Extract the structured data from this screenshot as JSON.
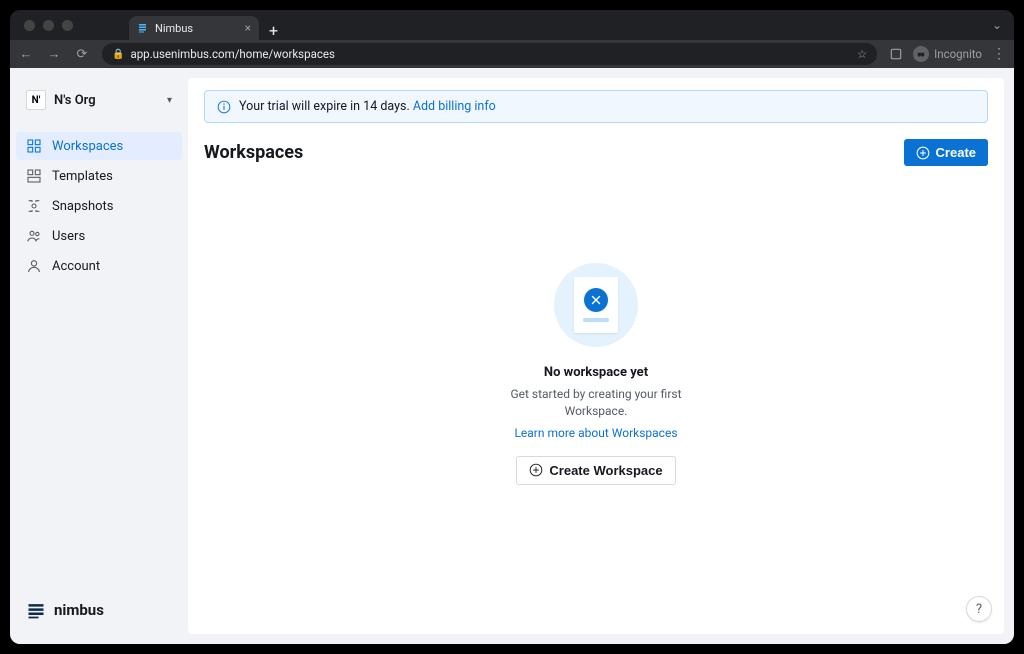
{
  "browser": {
    "tab_title": "Nimbus",
    "url": "app.usenimbus.com/home/workspaces",
    "incognito_label": "Incognito"
  },
  "org": {
    "initial": "N'",
    "name": "N's Org"
  },
  "nav": {
    "items": [
      {
        "label": "Workspaces"
      },
      {
        "label": "Templates"
      },
      {
        "label": "Snapshots"
      },
      {
        "label": "Users"
      },
      {
        "label": "Account"
      }
    ]
  },
  "brand": "nimbus",
  "banner": {
    "text": "Your trial will expire in 14 days.",
    "link": "Add billing info"
  },
  "page_title": "Workspaces",
  "create_button": "Create",
  "empty": {
    "title": "No workspace yet",
    "subtitle": "Get started by creating your first Workspace.",
    "learn_more": "Learn more about Workspaces",
    "cta": "Create Workspace"
  },
  "help": "?"
}
